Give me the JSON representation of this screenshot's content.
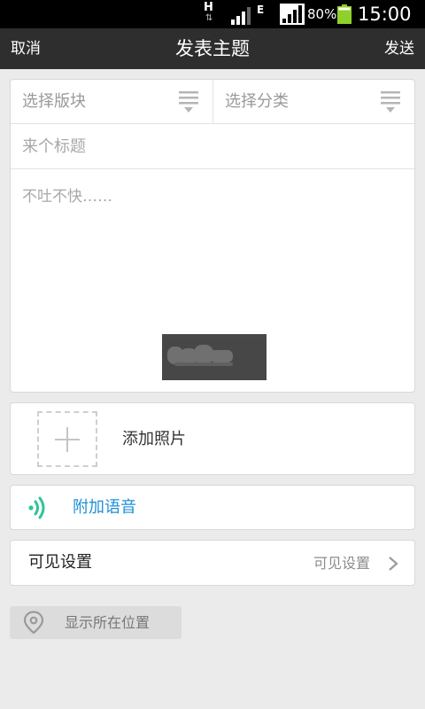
{
  "status_bar": {
    "network_h": "H",
    "network_e": "E",
    "battery_percent": "80%",
    "time": "15:00"
  },
  "header": {
    "cancel_label": "取消",
    "title": "发表主题",
    "send_label": "发送"
  },
  "compose": {
    "board_selector": {
      "label": "选择版块",
      "icon": "list-dropdown-icon"
    },
    "category_selector": {
      "label": "选择分类",
      "icon": "list-dropdown-icon"
    },
    "title_input": {
      "placeholder": "来个标题",
      "value": ""
    },
    "body_input": {
      "placeholder": "不吐不快……",
      "value": ""
    }
  },
  "attachments": {
    "photo": {
      "label": "添加照片",
      "icon": "plus-icon"
    },
    "voice": {
      "label": "附加语音",
      "icon": "sound-wave-icon"
    }
  },
  "visibility": {
    "label": "可见设置",
    "value": "可见设置",
    "icon": "chevron-right-icon"
  },
  "location": {
    "label": "显示所在位置",
    "icon": "location-pin-icon"
  },
  "colors": {
    "header_bg": "#2e2e2e",
    "page_bg": "#ebebeb",
    "accent_blue": "#1e90d8",
    "voice_green": "#2fc49a",
    "battery_green": "#8ed12a"
  }
}
